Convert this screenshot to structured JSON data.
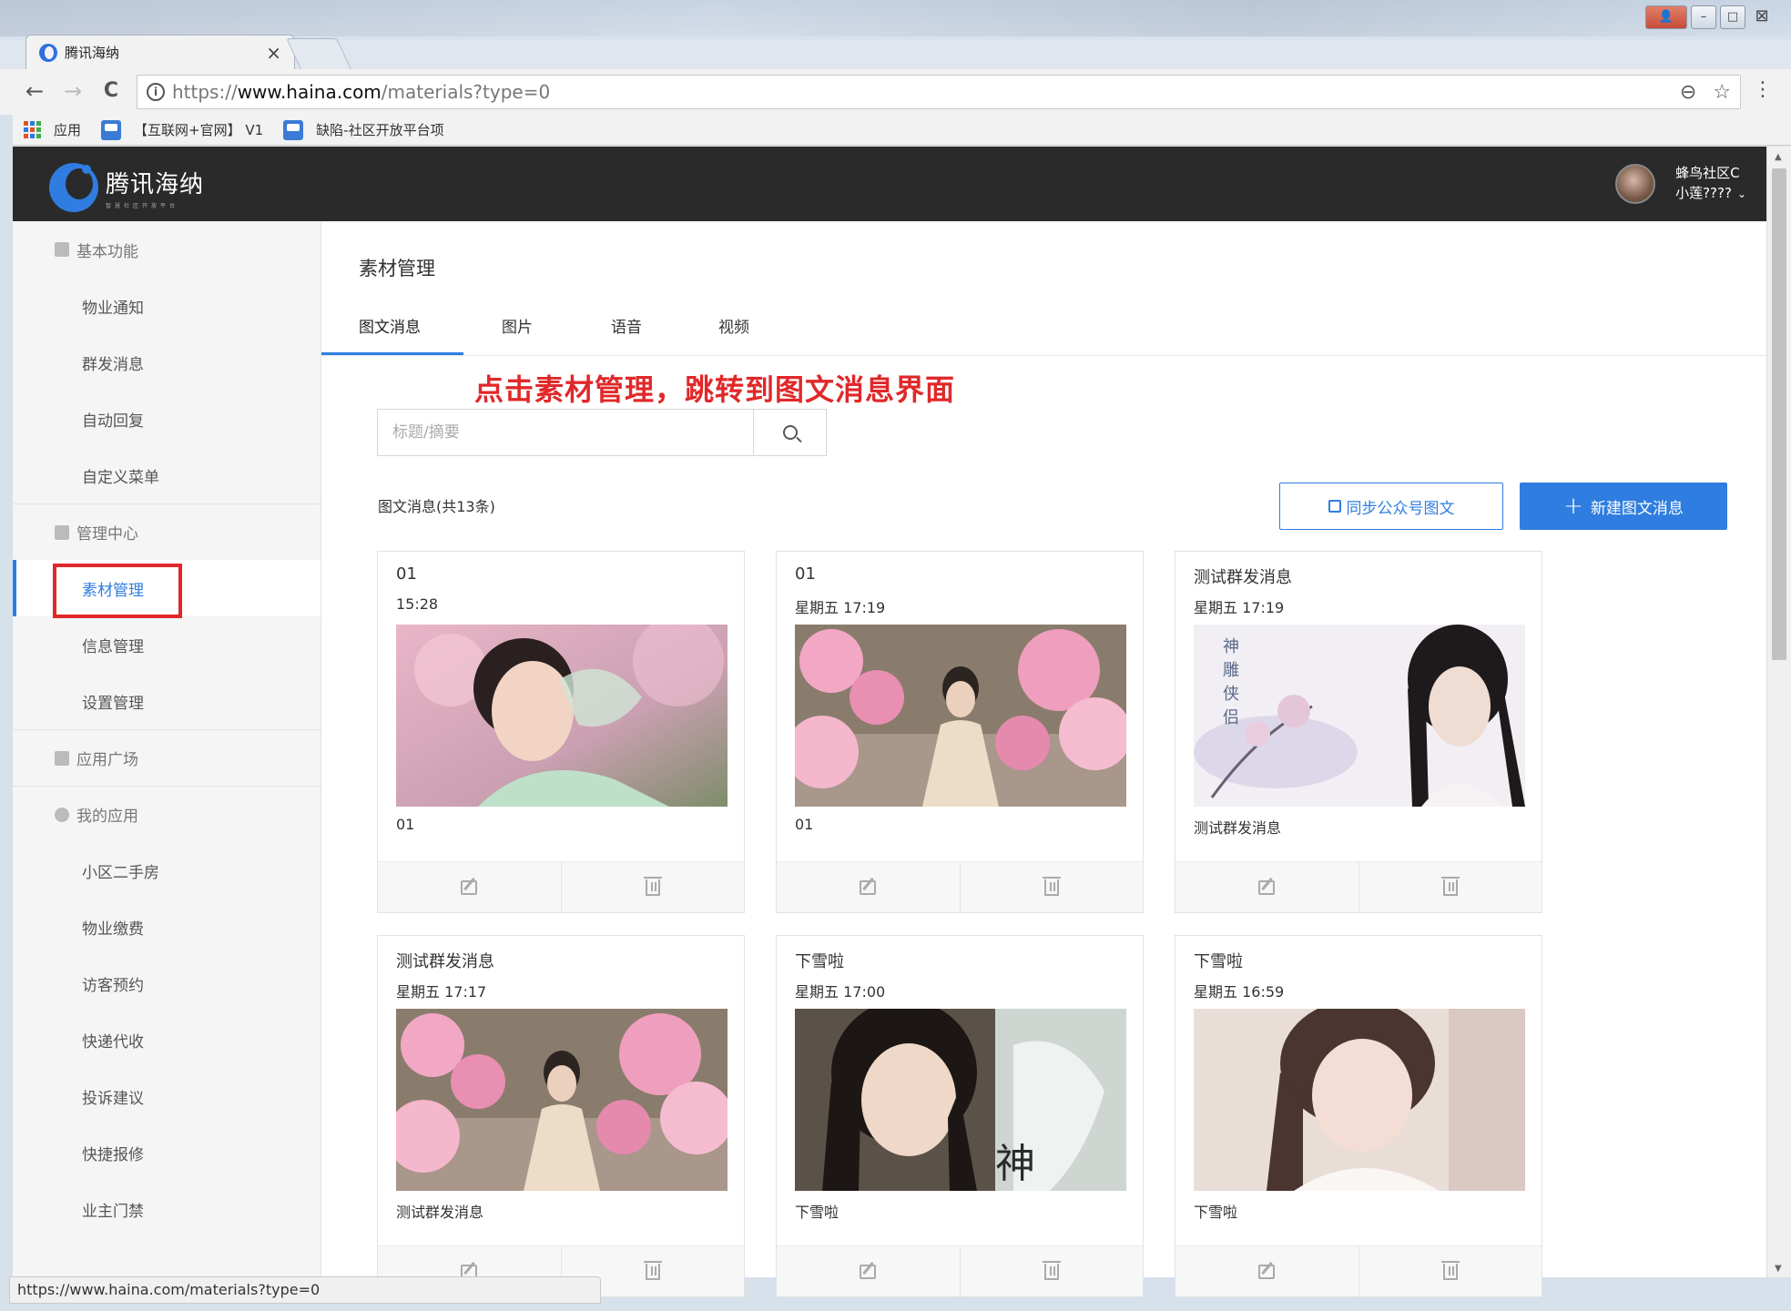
{
  "browser": {
    "tab_title": "腾讯海纳",
    "tab_close": "×",
    "url_scheme": "https://",
    "url_host": "www.haina.com",
    "url_path": "/materials?type=0",
    "back": "←",
    "forward": "→",
    "reload": "C",
    "zoom_icon": "⊖",
    "star_icon": "☆",
    "menu": "⋮",
    "bookmarks": [
      "应用",
      "【互联网+官网】 V1",
      "缺陷-社区开放平台项"
    ],
    "status_url": "https://www.haina.com/materials?type=0"
  },
  "header": {
    "logo_name": "腾讯海纳",
    "logo_sub": "智慧社区开放平台",
    "community": "蜂鸟社区C",
    "username": "小莲????",
    "caret": "⌄"
  },
  "sidebar": {
    "groups": [
      {
        "label": "基本功能",
        "items": [
          "物业通知",
          "群发消息",
          "自动回复",
          "自定义菜单"
        ]
      },
      {
        "label": "管理中心",
        "items": [
          "素材管理",
          "信息管理",
          "设置管理"
        ]
      },
      {
        "label": "应用广场",
        "items": []
      },
      {
        "label": "我的应用",
        "items": [
          "小区二手房",
          "物业缴费",
          "访客预约",
          "快递代收",
          "投诉建议",
          "快捷报修",
          "业主门禁"
        ]
      }
    ],
    "active_item": "素材管理"
  },
  "main": {
    "page_title": "素材管理",
    "tabs": [
      "图文消息",
      "图片",
      "语音",
      "视频"
    ],
    "active_tab": "图文消息",
    "annotation": "点击素材管理，跳转到图文消息界面",
    "search_placeholder": "标题/摘要",
    "count_label": "图文消息(共13条)",
    "sync_button": "同步公众号图文",
    "new_button": "新建图文消息",
    "new_button_plus": "+"
  },
  "cards": [
    {
      "title": "01",
      "time": "15:28",
      "digest": "01",
      "image": "portrait-pink-blossom"
    },
    {
      "title": "01",
      "time": "星期五 17:19",
      "digest": "01",
      "image": "figure-peach-blossom"
    },
    {
      "title": "测试群发消息",
      "time": "星期五 17:19",
      "digest": "测试群发消息",
      "image": "ink-painting-portrait"
    },
    {
      "title": "测试群发消息",
      "time": "星期五 17:17",
      "digest": "测试群发消息",
      "image": "figure-peach-blossom"
    },
    {
      "title": "下雪啦",
      "time": "星期五 17:00",
      "digest": "下雪啦",
      "image": "portrait-dark-hair"
    },
    {
      "title": "下雪啦",
      "time": "星期五 16:59",
      "digest": "下雪啦",
      "image": "portrait-light"
    }
  ],
  "colors": {
    "accent": "#2f7de0",
    "annotation_red": "#e0282a",
    "header_bg": "#2a2a2a"
  }
}
